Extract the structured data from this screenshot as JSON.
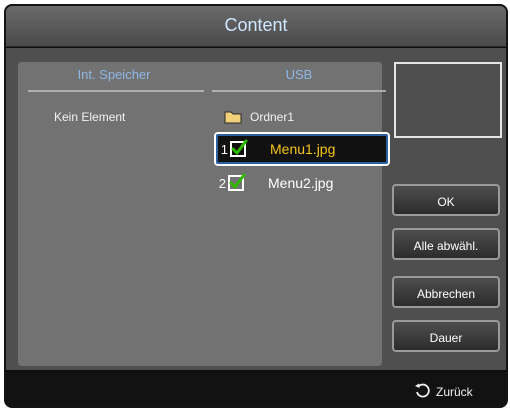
{
  "window": {
    "title": "Content"
  },
  "columns": {
    "left_header": "Int. Speicher",
    "right_header": "USB"
  },
  "left_list": {
    "empty_text": "Kein Element"
  },
  "right_list": {
    "folder": {
      "name": "Ordner1",
      "icon": "folder-icon"
    },
    "files": [
      {
        "index": "1",
        "name": "Menu1.jpg",
        "checked": true,
        "selected": true
      },
      {
        "index": "2",
        "name": "Menu2.jpg",
        "checked": true,
        "selected": false
      }
    ]
  },
  "buttons": {
    "ok": "OK",
    "deselect_all": "Alle abwähl.",
    "cancel": "Abbrechen",
    "duration": "Dauer"
  },
  "footer": {
    "back_label": "Zurück",
    "back_icon": "return-arrow-icon"
  },
  "colors": {
    "accent_text": "#8fb7e6",
    "selected_text": "#f5c518",
    "check_green": "#2fb800"
  }
}
